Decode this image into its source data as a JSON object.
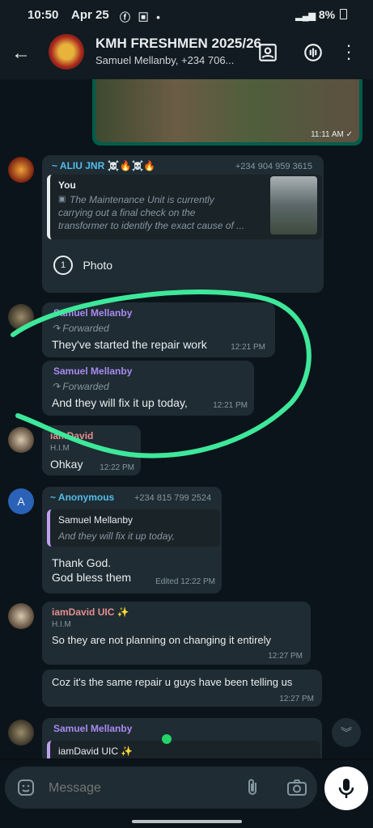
{
  "status_bar": {
    "time": "10:50",
    "date": "Apr 25",
    "icons": "ⓕ ▣ •",
    "battery": "8%"
  },
  "header": {
    "group_name": "KMH FRESHMEN 2025/26",
    "members": "Samuel Mellanby, +234 706..."
  },
  "image_message": {
    "time": "11:11 AM ✓"
  },
  "messages": {
    "aliu": {
      "sender": "~ ALIU JNR ☠️🔥☠️🔥",
      "phone": "+234 904 959 3615",
      "quote_author": "You",
      "quote_text_1": "The Maintenance Unit is currently",
      "quote_text_2": "carrying out a final check on the",
      "quote_text_3": "transformer to identify the exact cause of ...",
      "photo_label": "Photo",
      "photo_badge": "1"
    },
    "sam1": {
      "sender": "Samuel Mellanby",
      "forwarded": "Forwarded",
      "text": "They've started the repair work",
      "time": "12:21 PM"
    },
    "sam2": {
      "sender": "Samuel Mellanby",
      "forwarded": "Forwarded",
      "text": "And they will fix it up today,",
      "time": "12:21 PM"
    },
    "david1": {
      "sender": "iamDavid",
      "tag": "H.I.M",
      "text": "Ohkay",
      "time": "12:22 PM"
    },
    "anon": {
      "avatar_letter": "A",
      "sender": "~ Anonymous",
      "phone": "+234 815 799 2524",
      "quote_author": "Samuel Mellanby",
      "quote_text": "And they will fix it up today,",
      "text_1": "Thank God.",
      "text_2": "God  bless them",
      "time": "Edited  12:22 PM"
    },
    "david2": {
      "sender": "iamDavid UIC ✨",
      "tag": "H.I.M",
      "text": "So they are not planning on changing it entirely",
      "time": "12:27 PM"
    },
    "david3": {
      "text": "Coz it's the same repair u guys have been telling us",
      "time": "12:27 PM"
    },
    "sam3": {
      "sender": "Samuel Mellanby",
      "quote_author": "iamDavid UIC ✨"
    }
  },
  "input": {
    "placeholder": "Message"
  },
  "colors": {
    "accent": "#25d366",
    "bubble": "#1f2c33",
    "annotation": "#3ee89a"
  }
}
